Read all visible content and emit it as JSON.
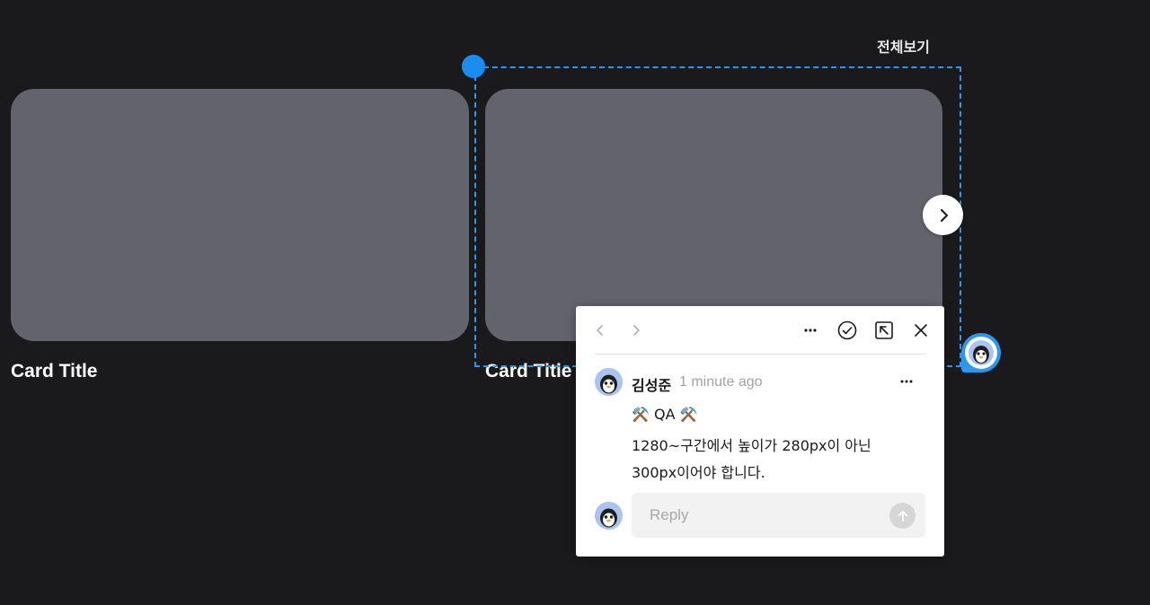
{
  "header": {
    "view_all_label": "전체보기"
  },
  "cards": [
    {
      "title": "Card Title"
    },
    {
      "title": "Card Title"
    }
  ],
  "icons": {
    "next": "chevron-right-icon",
    "comment_pin": "comment-pin-icon",
    "prev_comment": "chevron-left-icon",
    "next_comment": "chevron-right-icon",
    "more": "more-horizontal-icon",
    "resolve": "check-circle-icon",
    "open_full": "arrow-up-left-box-icon",
    "close": "close-icon",
    "send": "arrow-up-icon"
  },
  "colors": {
    "background": "#1a1a1c",
    "card": "#63636d",
    "selection": "#2b97f0",
    "panel": "#ffffff"
  },
  "comment": {
    "author": "김성준",
    "timestamp": "1 minute ago",
    "lines": [
      "⚒️  QA ⚒️",
      "1280~구간에서 높이가 280px이 아닌",
      "300px이어야 합니다."
    ],
    "reply_placeholder": "Reply"
  }
}
